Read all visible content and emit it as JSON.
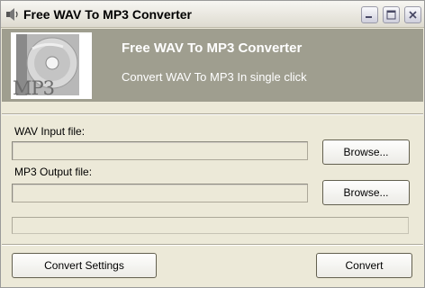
{
  "window": {
    "title": "Free WAV To MP3 Converter",
    "icons": {
      "app": "speaker-icon",
      "minimize": "minimize-icon",
      "maximize": "maximize-icon",
      "close": "close-icon"
    }
  },
  "banner": {
    "title": "Free WAV To MP3 Converter",
    "subtitle": "Convert WAV To MP3 In single click",
    "logo_text": "MP3",
    "logo_icon": "cd-disc-icon",
    "background_color": "#9f9e8f"
  },
  "input": {
    "label": "WAV Input file:",
    "value": "",
    "browse_label": "Browse..."
  },
  "output": {
    "label": "MP3 Output file:",
    "value": "",
    "browse_label": "Browse..."
  },
  "progress": {
    "value": 0
  },
  "actions": {
    "settings_label": "Convert Settings",
    "convert_label": "Convert"
  }
}
